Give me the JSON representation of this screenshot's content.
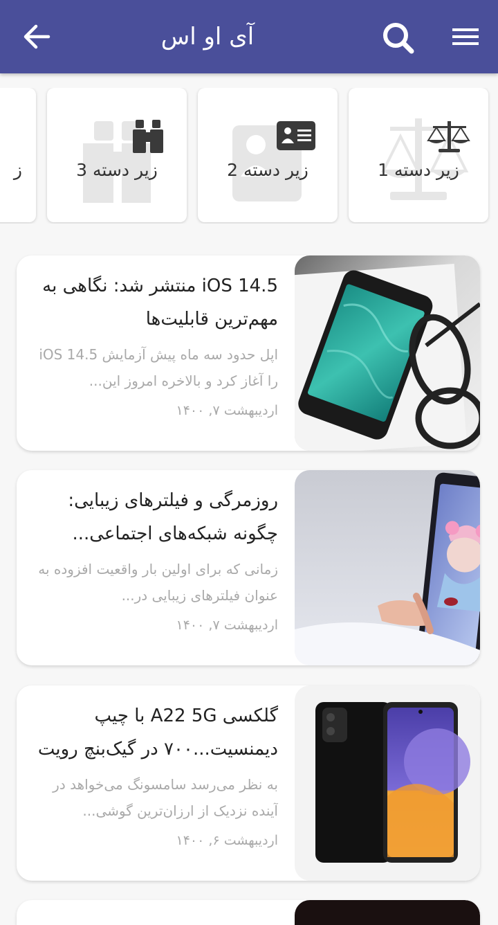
{
  "appbar": {
    "title": "آی او اس",
    "icons": [
      "back-arrow-icon",
      "search-icon",
      "menu-icon"
    ],
    "color": "#4a4f9a"
  },
  "categories": [
    {
      "label": "زیر دسته 1",
      "icon": "scales-icon"
    },
    {
      "label": "زیر دسته 2",
      "icon": "contact-card-icon"
    },
    {
      "label": "زیر دسته 3",
      "icon": "binoculars-icon"
    },
    {
      "label": "ز",
      "icon": ""
    }
  ],
  "articles": [
    {
      "headline": "iOS 14.5 منتشر شد: نگاهی به مهم‌ترین قابلیت‌ها",
      "excerpt": "اپل حدود سه ماه پیش آزمایش iOS 14.5 را آغاز کرد و بالاخره امروز این...",
      "date": "اردیبهشت ۷, ۱۴۰۰"
    },
    {
      "headline": "روزمرگی و فیلترهای زیبایی: چگونه شبکه‌های اجتماعی...",
      "excerpt": "زمانی که برای اولین بار واقعیت افزوده به عنوان فیلترهای زیبایی در...",
      "date": "اردیبهشت ۷, ۱۴۰۰"
    },
    {
      "headline": "گلکسی A22 5G با چیپ دیمنسیت...۷۰۰ در گیک‌بنچ رویت",
      "excerpt": "به نظر می‌رسد سامسونگ می‌خواهد در آینده نزدیک از ارزان‌ترین گوشی...",
      "date": "اردیبهشت ۶, ۱۴۰۰"
    }
  ]
}
